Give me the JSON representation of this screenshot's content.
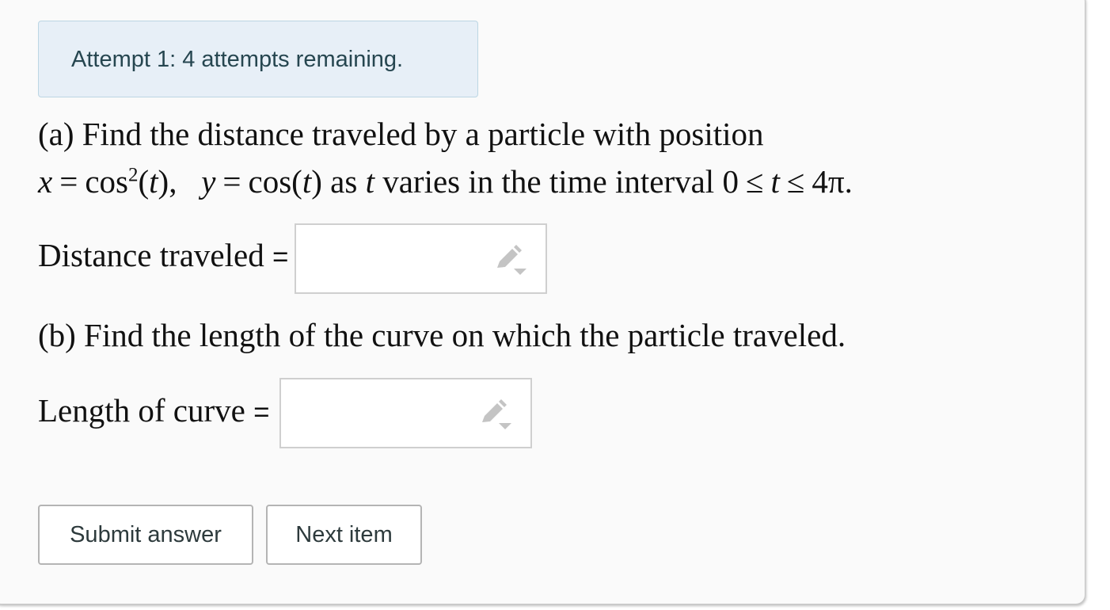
{
  "attempt_banner": "Attempt 1: 4 attempts remaining.",
  "part_a": {
    "line1": "(a) Find the distance traveled by a particle with position",
    "x_var": "x",
    "eq": "=",
    "x_func": "cos",
    "x_exp": "2",
    "open": "(",
    "t": "t",
    "close1": "),",
    "y_var": "y",
    "y_func": "cos(",
    "close2": ")",
    "as_text": "as",
    "varies_text": "varies in the time interval 0",
    "le": "≤",
    "end_text": "4π."
  },
  "distance_label": "Distance traveled",
  "length_label": "Length of curve",
  "equals_sign": "=",
  "part_b": "(b) Find the length of the curve on which the particle traveled.",
  "buttons": {
    "submit": "Submit answer",
    "next": "Next item"
  },
  "icons": {
    "answer_editor": "pencil-dropdown-icon"
  },
  "colors": {
    "banner_bg": "#e7eff7",
    "banner_text": "#264650",
    "button_border": "#b4b4b4"
  }
}
